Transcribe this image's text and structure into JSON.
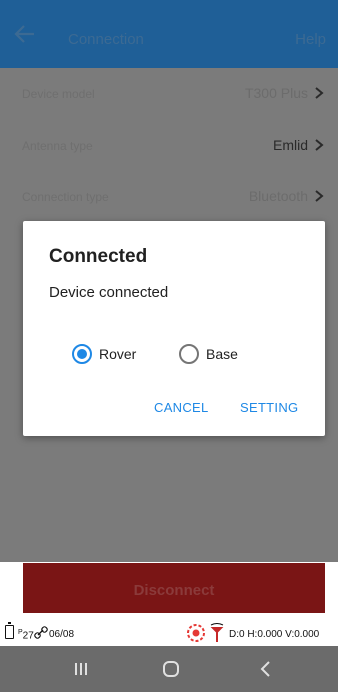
{
  "app_bar": {
    "title": "Connection",
    "help": "Help",
    "back_icon": "arrow-left-icon"
  },
  "settings": [
    {
      "label": "Device model",
      "value": "T300 Plus"
    },
    {
      "label": "Antenna type",
      "value": "Emlid"
    },
    {
      "label": "Connection type",
      "value": "Bluetooth"
    }
  ],
  "dialog": {
    "title": "Connected",
    "message": "Device connected",
    "options": [
      {
        "label": "Rover",
        "selected": true
      },
      {
        "label": "Base",
        "selected": false
      }
    ],
    "cancel": "CANCEL",
    "setting": "SETTING"
  },
  "disconnect_label": "Disconnect",
  "status_bar": {
    "satellites": "27",
    "satellites_sup": "P",
    "age": "06/08",
    "device_info": "D:0 H:0.000 V:0.000"
  },
  "colors": {
    "primary": "#1f5f97",
    "accent": "#1e88e5",
    "danger": "#7a1515"
  }
}
